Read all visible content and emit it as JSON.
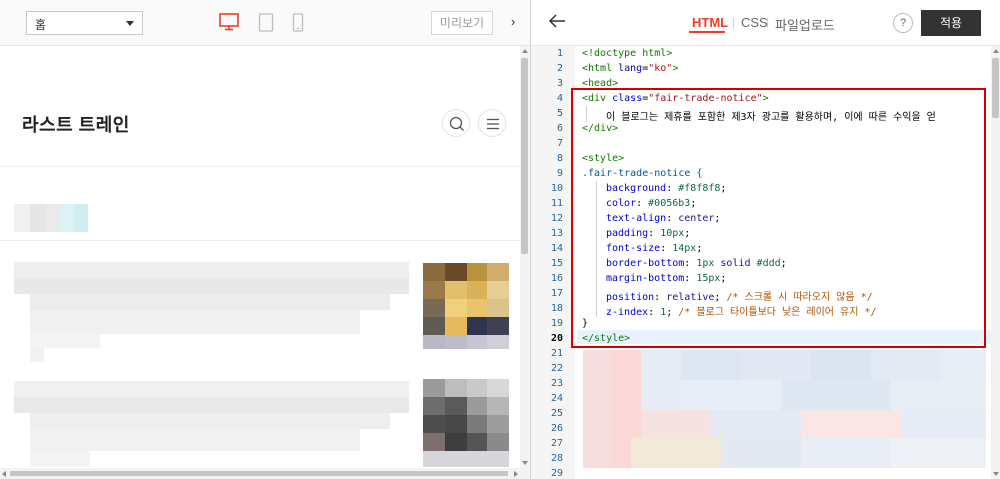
{
  "preview": {
    "page_select": "홈",
    "device_icons": [
      "desktop-icon",
      "tablet-icon",
      "mobile-icon"
    ],
    "preview_button": "미리보기",
    "collapse_glyph": "›",
    "blog_title": "라스트 트레인"
  },
  "editor": {
    "back_glyph": "←",
    "tabs": [
      {
        "label": "HTML",
        "active": true
      },
      {
        "label": "CSS",
        "active": false
      },
      {
        "label": "파일업로드",
        "active": false
      }
    ],
    "tab_separator": "|",
    "help_label": "?",
    "apply_label": "적용",
    "current_line": 20,
    "line_numbers": [
      "1",
      "2",
      "3",
      "4",
      "5",
      "6",
      "7",
      "8",
      "9",
      "10",
      "11",
      "12",
      "13",
      "14",
      "15",
      "16",
      "17",
      "18",
      "19",
      "20",
      "21",
      "22",
      "23",
      "24",
      "25",
      "26",
      "27",
      "28",
      "29"
    ],
    "code": {
      "l1": "<!doctype html>",
      "l2a": "<html ",
      "l2b": "lang",
      "l2c": "=",
      "l2d": "\"ko\"",
      "l2e": ">",
      "l3": "<head>",
      "l4a": "<div ",
      "l4b": "class",
      "l4c": "=",
      "l4d": "\"fair-trade-notice\"",
      "l4e": ">",
      "l5": "  이 블로그는 제휴를 포함한 제3자 광고를 활용하며, 이에 따른 수익을 얻",
      "l6": "</div>",
      "l8": "<style>",
      "l9": ".fair-trade-notice {",
      "l10a": "background",
      "l10b": ": ",
      "l10c": "#f8f8f8",
      "l10d": ";",
      "l11a": "color",
      "l11b": ": ",
      "l11c": "#0056b3",
      "l11d": ";",
      "l12a": "text-align",
      "l12b": ": ",
      "l12c": "center",
      "l12d": ";",
      "l13a": "padding",
      "l13b": ": ",
      "l13c": "10px",
      "l13d": ";",
      "l14a": "font-size",
      "l14b": ": ",
      "l14c": "14px",
      "l14d": ";",
      "l15a": "border-bottom",
      "l15b": ": ",
      "l15c": "1px",
      "l15e": " solid ",
      "l15f": "#ddd",
      "l15d": ";",
      "l16a": "margin-bottom",
      "l16b": ": ",
      "l16c": "15px",
      "l16d": ";",
      "l17a": "position",
      "l17b": ": ",
      "l17c": "relative",
      "l17d": "; ",
      "l17e": "/* 스크롤 시 따라오지 않음 */",
      "l18a": "z-index",
      "l18b": ": ",
      "l18c": "1",
      "l18d": "; ",
      "l18e": "/* 블로그 타이틀보다 낮은 레이어 유지 */",
      "l19": "}",
      "l20": "</style>"
    }
  },
  "colors": {
    "accent_red": "#e8412b",
    "apply_bg": "#333333",
    "highlight_border": "#d40000",
    "line_number": "#2a6496"
  }
}
